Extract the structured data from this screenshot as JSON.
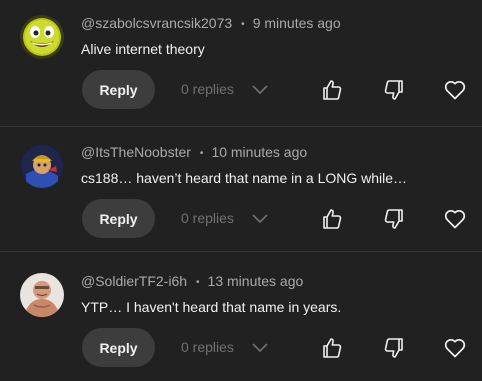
{
  "comments": [
    {
      "author": "@szabolcsvrancsik2073",
      "time": "9 minutes ago",
      "text": "Alive internet theory",
      "reply_label": "Reply",
      "replies_label": "0 replies"
    },
    {
      "author": "@ItsTheNoobster",
      "time": "10 minutes ago",
      "text": "cs188… haven’t heard that name in a LONG while…",
      "reply_label": "Reply",
      "replies_label": "0 replies"
    },
    {
      "author": "@SoldierTF2-i6h",
      "time": "13 minutes ago",
      "text": "YTP… I haven't heard that name in years.",
      "reply_label": "Reply",
      "replies_label": "0 replies"
    }
  ],
  "separator": "•",
  "icons": {
    "like": "thumbs-up-icon",
    "dislike": "thumbs-down-icon",
    "heart": "heart-icon",
    "expand": "chevron-down-icon"
  },
  "colors": {
    "background": "#212121",
    "text": "#f1f1f1",
    "muted": "#aaaaaa",
    "disabled": "#717171",
    "button": "#3d3d3d"
  }
}
